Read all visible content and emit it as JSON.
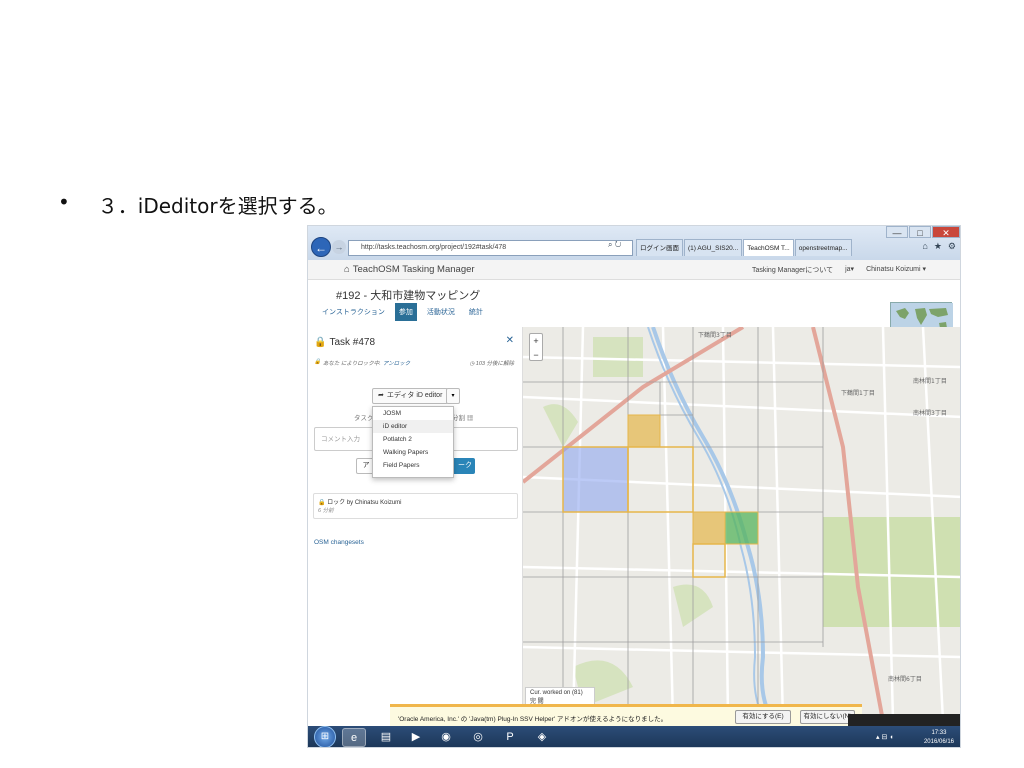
{
  "slide": {
    "bullet": "•",
    "heading": "３．iDeditorを選択する。"
  },
  "browser": {
    "url": "http://tasks.teachosm.org/project/192#task/478",
    "tabs": [
      {
        "label": "ログイン画面",
        "active": false
      },
      {
        "label": "(1) AGU_SIS20...",
        "active": false
      },
      {
        "label": "TeachOSM T...",
        "active": true
      },
      {
        "label": "openstreetmap...",
        "active": false
      }
    ],
    "window_buttons": {
      "minimize": "—",
      "maximize": "□",
      "close": "✕"
    }
  },
  "site": {
    "brand": "TeachOSM Tasking Manager",
    "nav_about": "Tasking Managerについて",
    "nav_lang": "ja▾",
    "nav_user": "Chinatsu Koizumi ▾",
    "project_title": "#192 - 大和市建物マッピング",
    "project_tabs": [
      {
        "label": "インストラクション",
        "active": false
      },
      {
        "label": "参加",
        "active": true
      },
      {
        "label": "活動状況",
        "active": false
      },
      {
        "label": "統計",
        "active": false
      }
    ]
  },
  "task_panel": {
    "title": "Task #478",
    "lock_prefix": "あなた によりロック中.",
    "unlock_link": "アンロック",
    "time_info": "103 分後に解除",
    "editor_button": "エディタ iD editor",
    "task_label": "タスク",
    "split_label": "分割",
    "comment_placeholder": "コメント入力",
    "btn_left": "ア",
    "btn_right": "ーク",
    "editor_options": [
      {
        "label": "JOSM",
        "active": false
      },
      {
        "label": "iD editor",
        "active": true
      },
      {
        "label": "Potlatch 2",
        "active": false
      },
      {
        "label": "Walking Papers",
        "active": false
      },
      {
        "label": "Field Papers",
        "active": false
      }
    ],
    "history_line": "ロック by Chinatsu Koizumi",
    "history_time": "6 分前",
    "changesets_link": "OSM changesets"
  },
  "map": {
    "zoom_in": "+",
    "zoom_out": "−",
    "legend_line1": "Cur. worked on (81)",
    "legend_line2": "完  閲",
    "street_labels": [
      "下鶴間3丁目",
      "下鶴間1丁目",
      "南林間1丁目",
      "南林間3丁目",
      "南林間6丁目"
    ],
    "colors": {
      "background": "#ecebe6",
      "river": "#a8c8e8",
      "main_road": "#e3a69a",
      "grid": "#9e9e9e",
      "selected": "#8fa6f0",
      "done": "#e6b64a",
      "validated": "#56b45c",
      "park": "#cfe0b1"
    }
  },
  "notification": {
    "text": "'Oracle America, Inc.' の 'Java(tm) Plug-In SSV Helper' アドオンが使えるようになりました。",
    "enable_button": "有効にする(E)",
    "disable_button": "有効にしない(N)"
  },
  "taskbar": {
    "time": "17:33",
    "date": "2016/06/16"
  }
}
